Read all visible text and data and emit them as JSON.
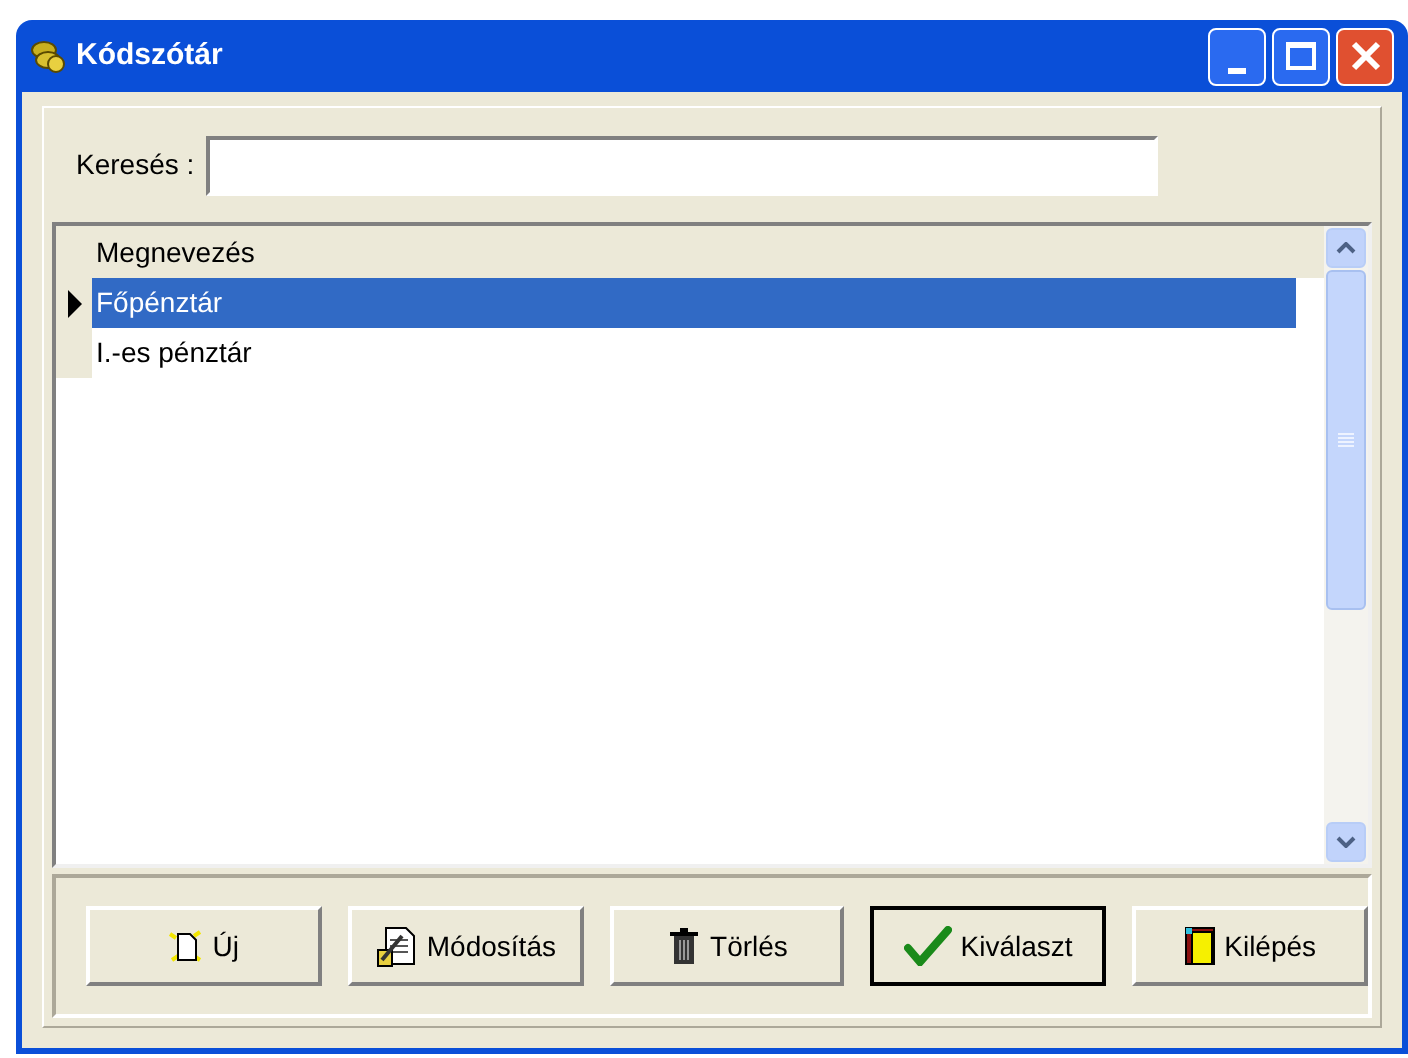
{
  "window": {
    "title": "Kódszótár"
  },
  "search": {
    "label": "Keresés :"
  },
  "grid": {
    "columns": [
      "Megnevezés"
    ],
    "rows": [
      {
        "name": "Főpénztár",
        "selected": true
      },
      {
        "name": "I.-es pénztár",
        "selected": false
      }
    ]
  },
  "buttons": [
    {
      "label": "Új",
      "kind": "new",
      "default": false
    },
    {
      "label": "Módosítás",
      "kind": "edit",
      "default": false
    },
    {
      "label": "Törlés",
      "kind": "delete",
      "default": false
    },
    {
      "label": "Kiválaszt",
      "kind": "select",
      "default": true
    },
    {
      "label": "Kilépés",
      "kind": "exit",
      "default": false
    }
  ]
}
